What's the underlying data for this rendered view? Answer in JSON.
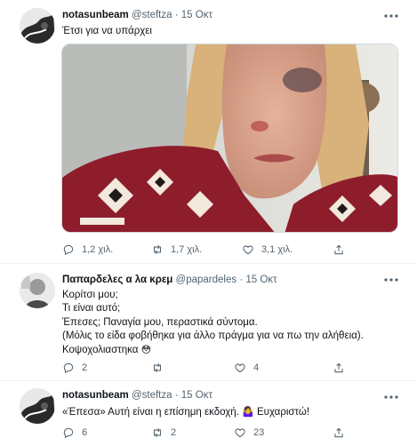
{
  "tweets": [
    {
      "name": "notasunbeam",
      "handle": "@steftza",
      "separator": "·",
      "date": "15 Οκτ",
      "lines": [
        "Έτσι για να υπάρχει"
      ],
      "actions": {
        "replies": "1,2 χιλ.",
        "retweets": "1,7 χιλ.",
        "likes": "3,1 χιλ."
      }
    },
    {
      "name": "Παπαρδελες α λα κρεμ",
      "handle": "@papardeles",
      "separator": "·",
      "date": "15 Οκτ",
      "lines": [
        "Κορίτσι μου;",
        "Τι είναι αυτό;",
        "Έπεσες; Παναγία μου, περαστικά σύντομα.",
        "(Μόλις το είδα φοβήθηκα για άλλο πράγμα για να πω την αλήθεια).",
        "Κοψοχολιαστηκα"
      ],
      "line5_emoji": "😳",
      "actions": {
        "replies": "2",
        "retweets": "",
        "likes": "4"
      }
    },
    {
      "name": "notasunbeam",
      "handle": "@steftza",
      "separator": "·",
      "date": "15 Οκτ",
      "lines": [
        "«Έπεσα» Αυτή είναι η επίσημη εκδοχή."
      ],
      "thanks_emoji": "🤷‍♀️",
      "thanks": "Ευχαριστώ!",
      "actions": {
        "replies": "6",
        "retweets": "2",
        "likes": "23"
      }
    }
  ],
  "colors": {
    "text": "#0f1419",
    "secondary": "#536471",
    "divider": "#eff3f4"
  },
  "icons": [
    "reply-icon",
    "retweet-icon",
    "like-icon",
    "share-icon",
    "more-icon"
  ]
}
